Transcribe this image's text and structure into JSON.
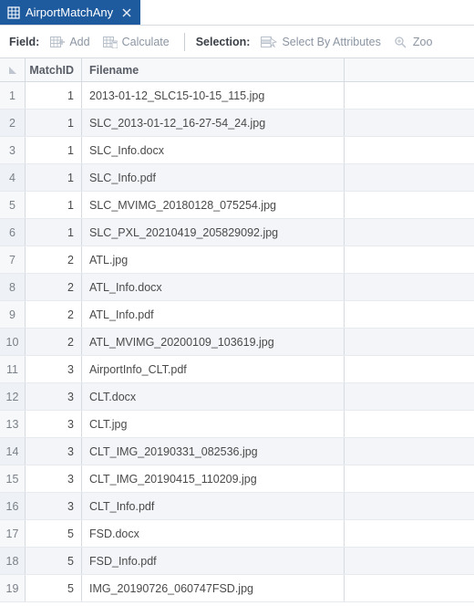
{
  "tab": {
    "title": "AirportMatchAny"
  },
  "toolbar": {
    "field_label": "Field:",
    "add_label": "Add",
    "calculate_label": "Calculate",
    "selection_label": "Selection:",
    "select_by_attributes_label": "Select By Attributes",
    "zoom_label": "Zoo"
  },
  "table": {
    "columns": {
      "matchid": "MatchID",
      "filename": "Filename"
    },
    "rows": [
      {
        "n": "1",
        "matchid": "1",
        "filename": "2013-01-12_SLC15-10-15_115.jpg"
      },
      {
        "n": "2",
        "matchid": "1",
        "filename": "SLC_2013-01-12_16-27-54_24.jpg"
      },
      {
        "n": "3",
        "matchid": "1",
        "filename": "SLC_Info.docx"
      },
      {
        "n": "4",
        "matchid": "1",
        "filename": "SLC_Info.pdf"
      },
      {
        "n": "5",
        "matchid": "1",
        "filename": "SLC_MVIMG_20180128_075254.jpg"
      },
      {
        "n": "6",
        "matchid": "1",
        "filename": "SLC_PXL_20210419_205829092.jpg"
      },
      {
        "n": "7",
        "matchid": "2",
        "filename": "ATL.jpg"
      },
      {
        "n": "8",
        "matchid": "2",
        "filename": "ATL_Info.docx"
      },
      {
        "n": "9",
        "matchid": "2",
        "filename": "ATL_Info.pdf"
      },
      {
        "n": "10",
        "matchid": "2",
        "filename": "ATL_MVIMG_20200109_103619.jpg"
      },
      {
        "n": "11",
        "matchid": "3",
        "filename": "AirportInfo_CLT.pdf"
      },
      {
        "n": "12",
        "matchid": "3",
        "filename": "CLT.docx"
      },
      {
        "n": "13",
        "matchid": "3",
        "filename": "CLT.jpg"
      },
      {
        "n": "14",
        "matchid": "3",
        "filename": "CLT_IMG_20190331_082536.jpg"
      },
      {
        "n": "15",
        "matchid": "3",
        "filename": "CLT_IMG_20190415_110209.jpg"
      },
      {
        "n": "16",
        "matchid": "3",
        "filename": "CLT_Info.pdf"
      },
      {
        "n": "17",
        "matchid": "5",
        "filename": "FSD.docx"
      },
      {
        "n": "18",
        "matchid": "5",
        "filename": "FSD_Info.pdf"
      },
      {
        "n": "19",
        "matchid": "5",
        "filename": "IMG_20190726_060747FSD.jpg"
      }
    ]
  }
}
